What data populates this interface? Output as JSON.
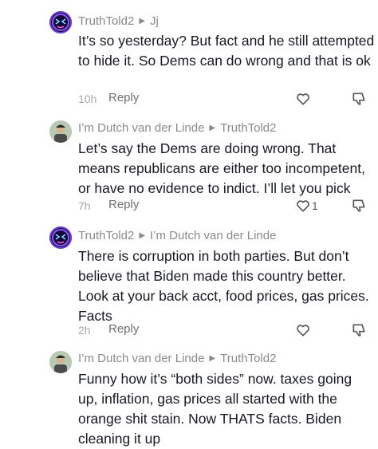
{
  "comments": [
    {
      "author": "TruthTold2",
      "reply_to": "Jj",
      "avatar": "neon-face-avatar",
      "text": "It’s so yesterday? But fact and he still attempted to hide it. So Dems can do wrong and that is ok",
      "time": "10h",
      "reply_label": "Reply",
      "likes": ""
    },
    {
      "author": "I’m Dutch van der Linde",
      "reply_to": "TruthTold2",
      "avatar": "person-avatar",
      "text": "Let’s say the Dems are doing wrong. That means republicans are either too incompetent, or have no evidence to indict. I’ll let you pick",
      "time": "7h",
      "reply_label": "Reply",
      "likes": "1"
    },
    {
      "author": "TruthTold2",
      "reply_to": "I’m Dutch van der Linde",
      "avatar": "neon-face-avatar",
      "text": "There is corruption in both parties. But don’t believe that Biden made this country better. Look at your back acct, food prices, gas prices. Facts",
      "time": "2h",
      "reply_label": "Reply",
      "likes": ""
    },
    {
      "author": "I’m Dutch van der Linde",
      "reply_to": "TruthTold2",
      "avatar": "person-avatar",
      "text": "Funny how it’s “both sides” now. taxes going up, inflation, gas prices all started with the orange shit stain. Now THATS facts. Biden cleaning it up",
      "time": "",
      "reply_label": "",
      "likes": ""
    }
  ]
}
